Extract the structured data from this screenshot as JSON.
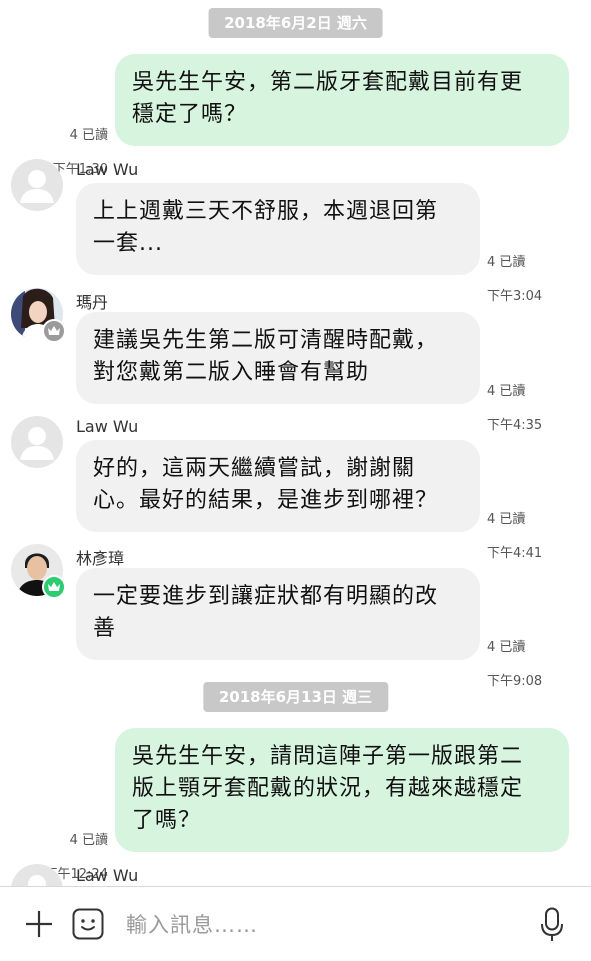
{
  "dates": [
    "2018年6月2日 週六",
    "2018年6月13日 週三"
  ],
  "messages": [
    {
      "text": "吳先生午安，第二版牙套配戴目前有更\n穩定了嗎？",
      "read": "4 已讀",
      "time": "下午1:30"
    },
    {
      "sender": "Law Wu",
      "text": "上上週戴三天不舒服，本週退回第\n一套...",
      "read": "4 已讀",
      "time": "下午3:04"
    },
    {
      "sender": "瑪丹",
      "text": "建議吳先生第二版可清醒時配戴，\n對您戴第二版入睡會有幫助",
      "read": "4 已讀",
      "time": "下午4:35"
    },
    {
      "sender": "Law Wu",
      "text": "好的，這兩天繼續嘗試，謝謝關\n心。最好的結果，是進步到哪裡？",
      "read": "4 已讀",
      "time": "下午4:41"
    },
    {
      "sender": "林彥璋",
      "text": "一定要進步到讓症狀都有明顯的改\n善",
      "read": "4 已讀",
      "time": "下午9:08"
    },
    {
      "text": "吳先生午安，請問這陣子第一版跟第二\n版上顎牙套配戴的狀況，有越來越穩定\n了嗎？",
      "read": "4 已讀",
      "time": "下午12:24"
    },
    {
      "sender": "Law Wu"
    }
  ],
  "input": {
    "placeholder": "輸入訊息……"
  },
  "colors": {
    "outgoing": "#d7f4df",
    "incoming": "#f1f1f1",
    "date_pill": "#c8c8c8",
    "crown_green": "#2ecc71",
    "crown_gray": "#9b9b9b"
  },
  "icons": {
    "plus": "plus-icon",
    "sticker": "sticker-icon",
    "mic": "microphone-icon"
  }
}
